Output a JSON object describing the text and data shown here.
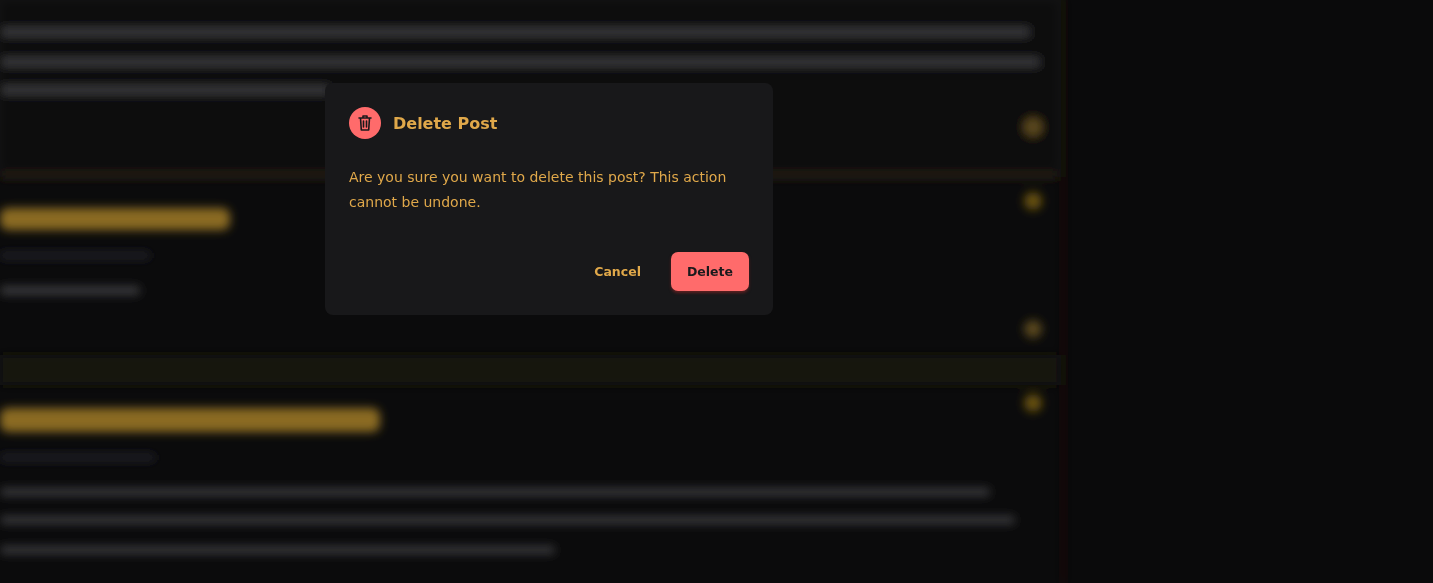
{
  "dialog": {
    "title": "Delete Post",
    "message": "Are you sure you want to delete this post? This action cannot be undone.",
    "buttons": [
      {
        "label": "Cancel",
        "kind": "secondary"
      },
      {
        "label": "Delete",
        "kind": "danger"
      }
    ]
  }
}
